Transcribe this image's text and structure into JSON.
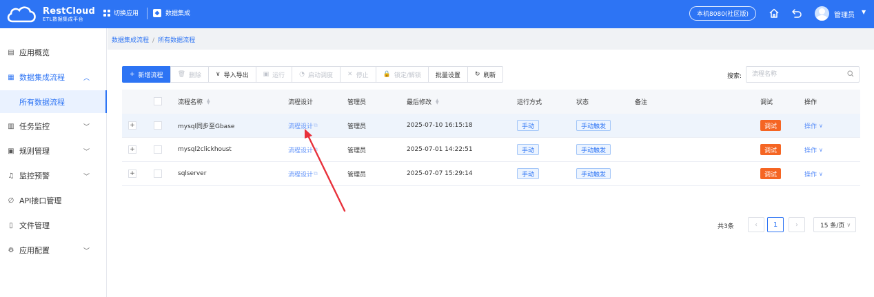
{
  "topbar": {
    "logo_main": "RestCloud",
    "logo_sub": "ETL数据集成平台",
    "switch_app": "切换应用",
    "current_app": "数据集成",
    "env": "本机8080(社区版)",
    "user": "管理员",
    "color": "#2d74f4"
  },
  "sidebar": {
    "items": [
      {
        "icon": "overview-icon",
        "label": "应用概览"
      },
      {
        "icon": "grid-icon",
        "label": "数据集成流程"
      },
      {
        "icon": "calendar-icon",
        "label": "任务监控"
      },
      {
        "icon": "rules-icon",
        "label": "规则管理"
      },
      {
        "icon": "alarm-icon",
        "label": "监控预警"
      },
      {
        "icon": "api-icon",
        "label": "API接口管理"
      },
      {
        "icon": "file-icon",
        "label": "文件管理"
      },
      {
        "icon": "settings-icon",
        "label": "应用配置"
      }
    ],
    "sub_item": "所有数据流程"
  },
  "breadcrumb": {
    "root": "数据集成流程",
    "sep": "/",
    "current": "所有数据流程"
  },
  "toolbar": {
    "add": "新增流程",
    "delete": "删除",
    "import_export": "导入导出",
    "run": "运行",
    "schedule": "启动调度",
    "stop": "停止",
    "lock": "锁定/解锁",
    "batch": "批量设置",
    "refresh": "刷新"
  },
  "search": {
    "label": "搜索:",
    "placeholder": "流程名称"
  },
  "table": {
    "columns": [
      "流程名称",
      "流程设计",
      "管理员",
      "最后修改",
      "运行方式",
      "状态",
      "备注",
      "调试",
      "操作"
    ],
    "rows": [
      {
        "name": "mysql同步至Gbase",
        "design": "流程设计",
        "admin": "管理员",
        "modified": "2025-07-10 16:15:18",
        "mode": "手动",
        "status": "手动触发",
        "note": "",
        "debug": "调试",
        "op": "操作"
      },
      {
        "name": "mysql2clickhoust",
        "design": "流程设计",
        "admin": "管理员",
        "modified": "2025-07-01 14:22:51",
        "mode": "手动",
        "status": "手动触发",
        "note": "",
        "debug": "调试",
        "op": "操作"
      },
      {
        "name": "sqlserver",
        "design": "流程设计",
        "admin": "管理员",
        "modified": "2025-07-07 15:29:14",
        "mode": "手动",
        "status": "手动触发",
        "note": "",
        "debug": "调试",
        "op": "操作"
      }
    ]
  },
  "pagination": {
    "total": "共3条",
    "page": "1",
    "page_size": "15 条/页"
  },
  "colors": {
    "primary": "#2d74f4",
    "debug": "#f56523",
    "arrow": "#e8313b"
  }
}
